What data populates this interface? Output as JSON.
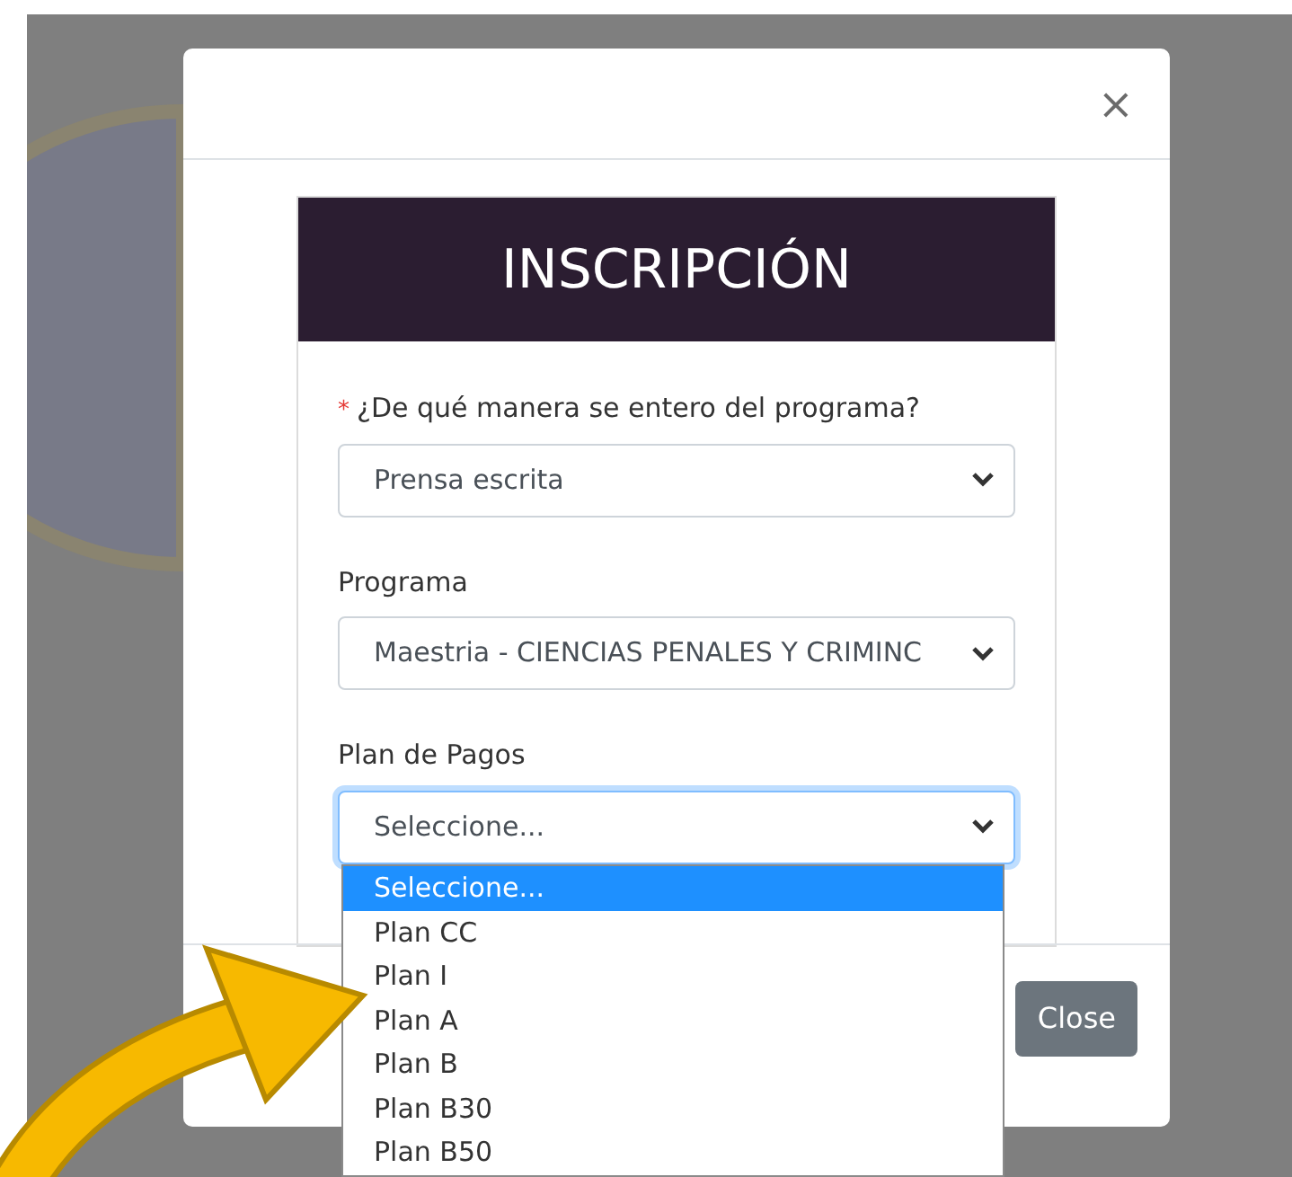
{
  "modal": {
    "close_icon": "×",
    "form": {
      "title": "INSCRIPCIÓN",
      "fields": [
        {
          "required_mark": "*",
          "label": "¿De qué manera se entero del programa?",
          "value": "Prensa escrita",
          "focused": false
        },
        {
          "label": "Programa",
          "value": "Maestria - CIENCIAS PENALES Y CRIMINC",
          "focused": false
        },
        {
          "label": "Plan de Pagos",
          "value": "Seleccione...",
          "focused": true
        }
      ]
    },
    "footer_button": "Close"
  },
  "dropdown": {
    "options": [
      {
        "label": "Seleccione...",
        "selected": true
      },
      {
        "label": "Plan CC",
        "selected": false
      },
      {
        "label": "Plan I",
        "selected": false
      },
      {
        "label": "Plan A",
        "selected": false
      },
      {
        "label": "Plan B",
        "selected": false
      },
      {
        "label": "Plan B30",
        "selected": false
      },
      {
        "label": "Plan B50",
        "selected": false
      }
    ]
  }
}
